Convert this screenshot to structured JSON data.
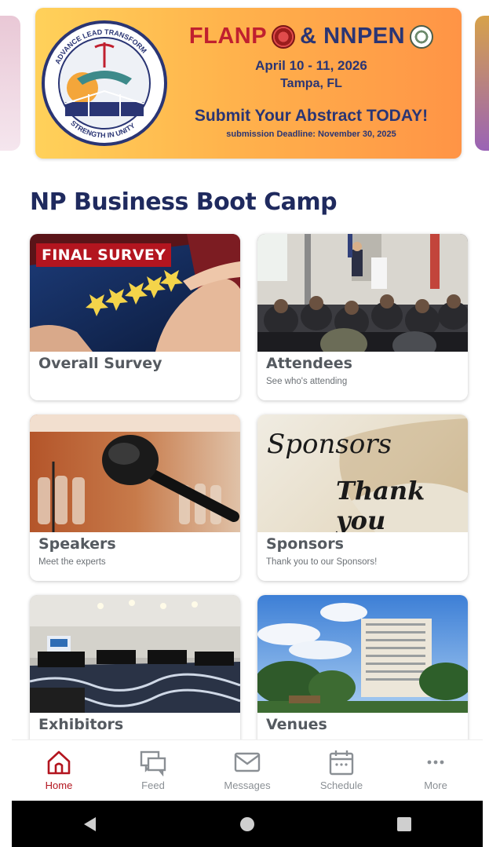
{
  "banner": {
    "seal_text_top": "ADVANCE LEAD TRANSFORM",
    "seal_text_bottom": "STRENGTH IN UNITY",
    "title_left": "FLANP",
    "title_right": "& NNPEN",
    "dates": "April 10 - 11, 2026",
    "city": "Tampa, FL",
    "cta": "Submit Your Abstract TODAY!",
    "deadline": "submission Deadline: November 30, 2025"
  },
  "section_title": "NP Business Boot Camp",
  "cards": [
    {
      "title": "Overall Survey",
      "subtitle": "",
      "tag": "FINAL SURVEY"
    },
    {
      "title": "Attendees",
      "subtitle": "See who's attending"
    },
    {
      "title": "Speakers",
      "subtitle": "Meet the experts"
    },
    {
      "title": "Sponsors",
      "subtitle": "Thank you to our Sponsors!",
      "script_top": "Sponsors",
      "script_bottom": "Thank you"
    },
    {
      "title": "Exhibitors",
      "subtitle": ""
    },
    {
      "title": "Venues",
      "subtitle": ""
    }
  ],
  "tabs": [
    {
      "label": "Home",
      "icon": "home-icon",
      "active": true
    },
    {
      "label": "Feed",
      "icon": "feed-icon"
    },
    {
      "label": "Messages",
      "icon": "mail-icon"
    },
    {
      "label": "Schedule",
      "icon": "calendar-icon"
    },
    {
      "label": "More",
      "icon": "more-icon"
    }
  ],
  "colors": {
    "accent": "#b3151f",
    "title_navy": "#1f2a5e",
    "tab_inactive": "#8a8f94"
  }
}
